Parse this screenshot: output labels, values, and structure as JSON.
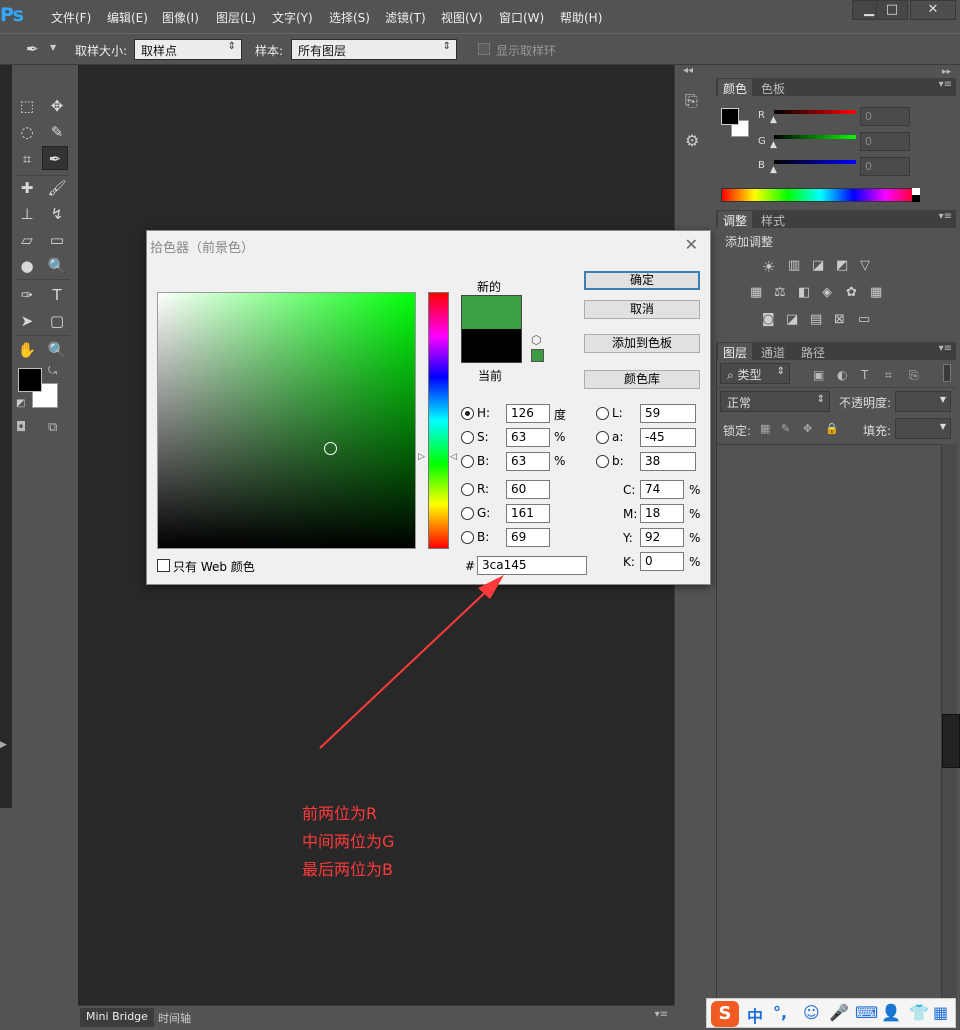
{
  "app": {
    "logo": "Ps"
  },
  "menu": [
    "文件(F)",
    "编辑(E)",
    "图像(I)",
    "图层(L)",
    "文字(Y)",
    "选择(S)",
    "滤镜(T)",
    "视图(V)",
    "窗口(W)",
    "帮助(H)"
  ],
  "window_controls": {
    "minimize": "▁",
    "restore": "□",
    "close": "✕"
  },
  "options": {
    "sample_size_label": "取样大小:",
    "sample_size_value": "取样点",
    "sample_label": "样本:",
    "sample_value": "所有图层",
    "show_ring_label": "显示取样环"
  },
  "bottom_tabs": [
    "Mini Bridge",
    "时间轴"
  ],
  "color_panel": {
    "tabs": [
      "颜色",
      "色板"
    ],
    "sliders": [
      {
        "label": "R",
        "value": "0",
        "color": "#ff0000"
      },
      {
        "label": "G",
        "value": "0",
        "color": "#00ff00"
      },
      {
        "label": "B",
        "value": "0",
        "color": "#0000ff"
      }
    ]
  },
  "adjust_panel": {
    "tabs": [
      "调整",
      "样式"
    ],
    "heading": "添加调整"
  },
  "layers_panel": {
    "tabs": [
      "图层",
      "通道",
      "路径"
    ],
    "filter_value": "类型",
    "blend_mode": "正常",
    "opacity_label": "不透明度:",
    "lock_label": "锁定:",
    "fill_label": "填充:"
  },
  "dialog": {
    "title": "拾色器（前景色）",
    "close": "✕",
    "new_label": "新的",
    "current_label": "当前",
    "new_color": "#3ca145",
    "current_color": "#000000",
    "buttons": [
      "确定",
      "取消",
      "添加到色板",
      "颜色库"
    ],
    "web_only_label": "只有 Web 颜色",
    "hsb": [
      {
        "label": "H:",
        "value": "126",
        "unit": "度",
        "selected": true
      },
      {
        "label": "S:",
        "value": "63",
        "unit": "%",
        "selected": false
      },
      {
        "label": "B:",
        "value": "63",
        "unit": "%",
        "selected": false
      }
    ],
    "rgb": [
      {
        "label": "R:",
        "value": "60"
      },
      {
        "label": "G:",
        "value": "161"
      },
      {
        "label": "B:",
        "value": "69"
      }
    ],
    "lab": [
      {
        "label": "L:",
        "value": "59"
      },
      {
        "label": "a:",
        "value": "-45"
      },
      {
        "label": "b:",
        "value": "38"
      }
    ],
    "cmyk": [
      {
        "label": "C:",
        "value": "74",
        "unit": "%"
      },
      {
        "label": "M:",
        "value": "18",
        "unit": "%"
      },
      {
        "label": "Y:",
        "value": "92",
        "unit": "%"
      },
      {
        "label": "K:",
        "value": "0",
        "unit": "%"
      }
    ],
    "hex_label": "#",
    "hex_value": "3ca145"
  },
  "annotation": {
    "lines": [
      "前两位为R",
      "中间两位为G",
      "最后两位为B"
    ],
    "color": "#ff3a3a"
  },
  "ime": {
    "logo": "S",
    "mode": "中",
    "punct": "°,"
  }
}
